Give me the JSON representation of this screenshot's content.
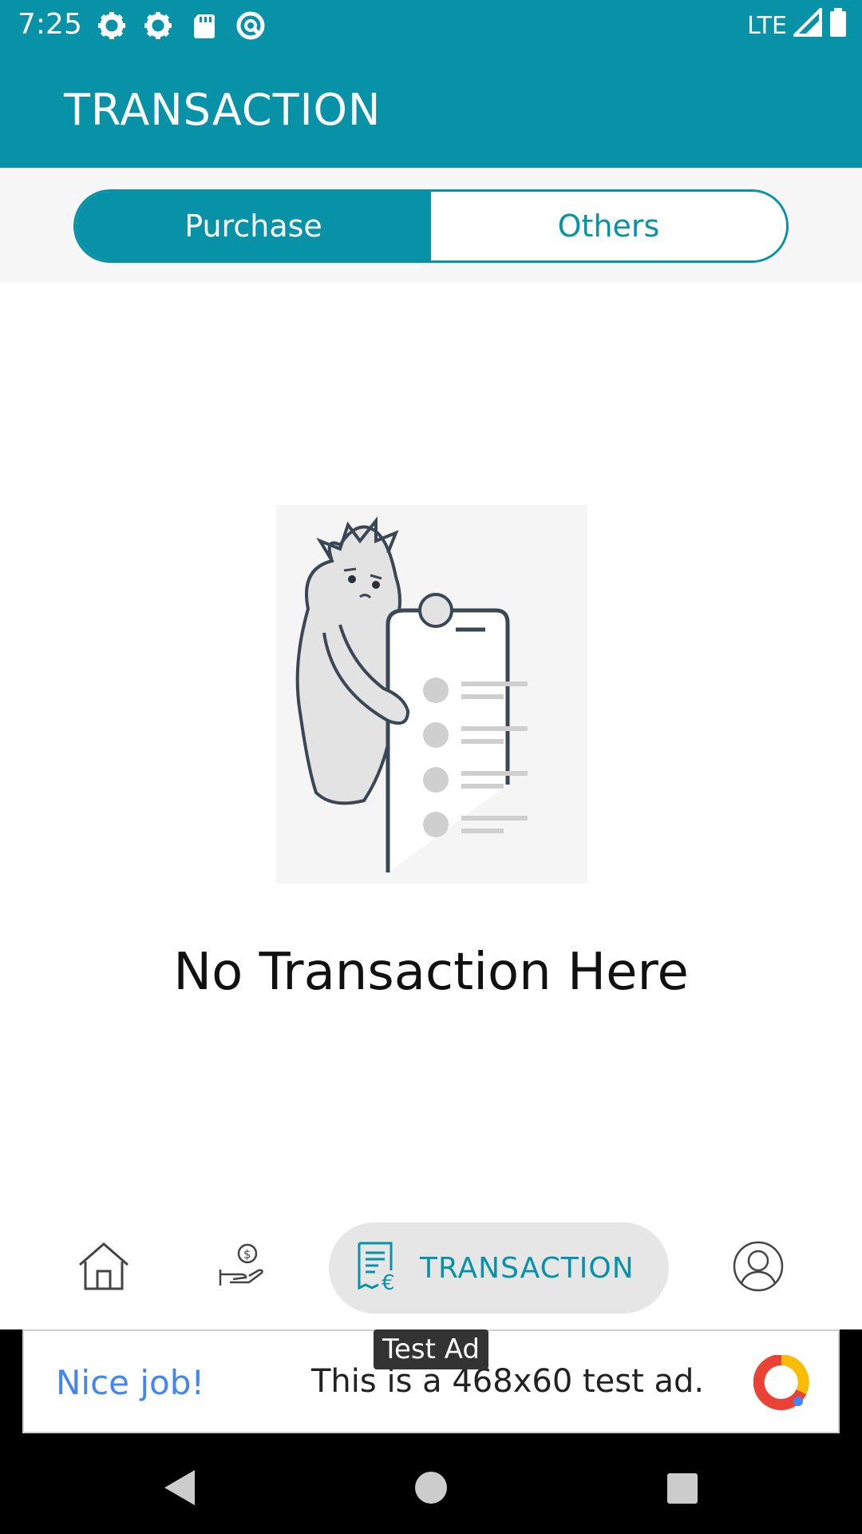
{
  "status_bar": {
    "time": "7:25",
    "network": "LTE"
  },
  "app_bar": {
    "title": "TRANSACTION"
  },
  "segment": {
    "tabs": [
      {
        "label": "Purchase",
        "active": true
      },
      {
        "label": "Others",
        "active": false
      }
    ]
  },
  "empty_state": {
    "message": "No Transaction Here"
  },
  "bottom_nav": {
    "items": [
      {
        "icon": "home-icon"
      },
      {
        "icon": "money-hand-icon"
      },
      {
        "icon": "receipt-euro-icon",
        "label": "TRANSACTION",
        "active": true
      },
      {
        "icon": "profile-icon"
      }
    ]
  },
  "ad": {
    "badge": "Test Ad",
    "headline": "Nice job!",
    "text": "This is a 468x60 test ad."
  },
  "colors": {
    "primary": "#0792a8",
    "nav_pill": "#e6e6e6",
    "ad_blue": "#4285f4"
  }
}
